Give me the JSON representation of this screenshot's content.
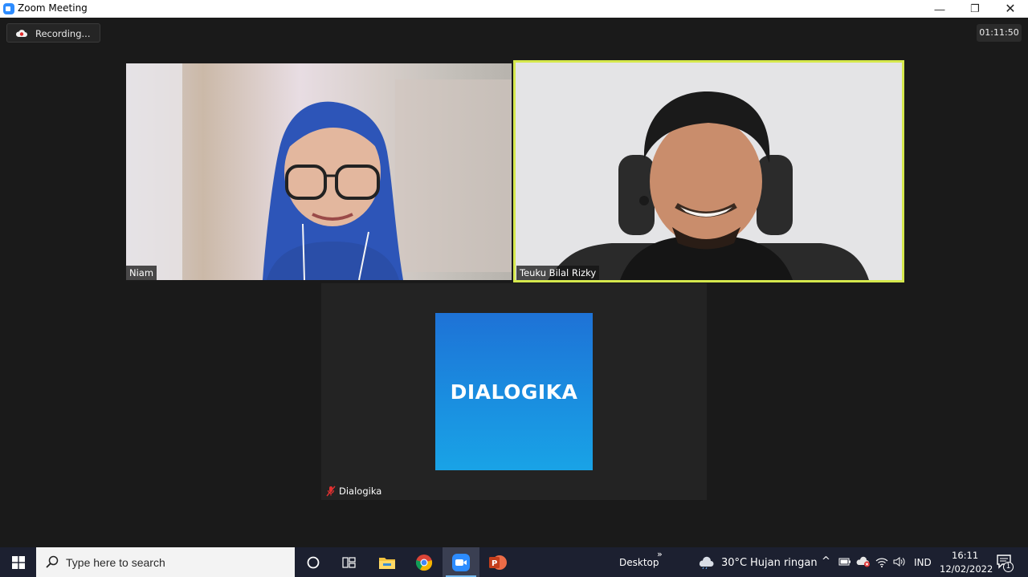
{
  "window": {
    "title": "Zoom Meeting",
    "minimize_glyph": "—",
    "restore_glyph": "❐",
    "close_glyph": "✕"
  },
  "meeting": {
    "recording_label": "Recording...",
    "elapsed_time": "01:11:50",
    "participants": [
      {
        "name": "Niam",
        "active_speaker": false
      },
      {
        "name": "Teuku Bilal Rizky",
        "active_speaker": true
      },
      {
        "name": "Dialogika",
        "muted": true
      }
    ],
    "logo_text": "DIALOGIKA",
    "active_speaker_color": "#d5e84d"
  },
  "taskbar": {
    "search_placeholder": "Type here to search",
    "desktop_label": "Desktop",
    "chevron": "»",
    "weather_temp": "30°C",
    "weather_desc": "Hujan ringan",
    "tray_up": "^",
    "language": "IND",
    "time": "16:11",
    "date": "12/02/2022",
    "notification_count": "1",
    "icons": [
      "windows-start-icon",
      "search-icon",
      "cortana-icon",
      "task-view-icon",
      "file-explorer-icon",
      "chrome-icon",
      "zoom-icon",
      "powerpoint-icon"
    ]
  }
}
